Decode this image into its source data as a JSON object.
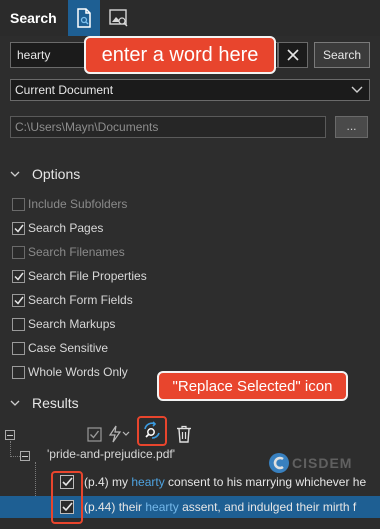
{
  "header": {
    "title": "Search",
    "tabs": [
      {
        "name": "document-search",
        "icon": "document-search-icon",
        "active": true
      },
      {
        "name": "image-search",
        "icon": "image-search-icon",
        "active": false
      }
    ]
  },
  "search": {
    "value": "hearty",
    "button_label": "Search"
  },
  "callouts": {
    "enter_word": "enter a word here",
    "replace_selected": "\"Replace Selected\" icon"
  },
  "scope": {
    "selected": "Current Document"
  },
  "path": {
    "value": "C:\\Users\\Mayn\\Documents",
    "browse_label": "..."
  },
  "options": {
    "heading": "Options",
    "items": [
      {
        "label": "Include Subfolders",
        "checked": false,
        "enabled": false
      },
      {
        "label": "Search Pages",
        "checked": true,
        "enabled": true
      },
      {
        "label": "Search Filenames",
        "checked": false,
        "enabled": false
      },
      {
        "label": "Search File Properties",
        "checked": true,
        "enabled": true
      },
      {
        "label": "Search Form Fields",
        "checked": true,
        "enabled": true
      },
      {
        "label": "Search Markups",
        "checked": false,
        "enabled": true
      },
      {
        "label": "Case Sensitive",
        "checked": false,
        "enabled": true
      },
      {
        "label": "Whole Words Only",
        "checked": false,
        "enabled": true
      }
    ]
  },
  "results": {
    "heading": "Results",
    "document": "'pride-and-prejudice.pdf'",
    "rows": [
      {
        "page": "(p.4)",
        "before": " my ",
        "match": "hearty",
        "after": " consent to his marrying whichever he",
        "checked": true,
        "selected": false
      },
      {
        "page": "(p.44)",
        "before": " their ",
        "match": "hearty",
        "after": " assent, and indulged their mirth f",
        "checked": true,
        "selected": true
      }
    ]
  },
  "watermark": {
    "text": "CISDEM"
  },
  "colors": {
    "background": "#2d2d2d",
    "accent": "#1e5f93",
    "highlight": "#e8452d",
    "match": "#4fa3e0"
  }
}
